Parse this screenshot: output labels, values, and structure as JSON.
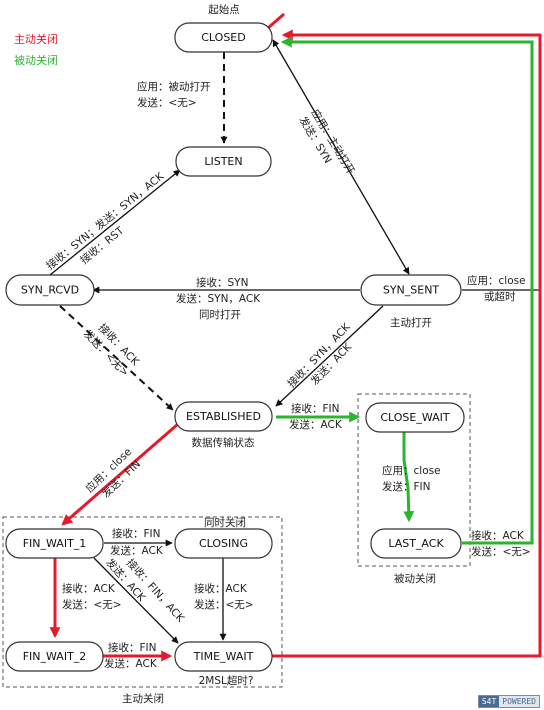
{
  "title": "起始点",
  "legend": {
    "active_close": {
      "text": "主动关闭",
      "color": "#e8192c"
    },
    "passive_close": {
      "text": "被动关闭",
      "color": "#2ab52e"
    }
  },
  "states": {
    "closed": "CLOSED",
    "listen": "LISTEN",
    "syn_rcvd": "SYN_RCVD",
    "syn_sent": "SYN_SENT",
    "established": "ESTABLISHED",
    "close_wait": "CLOSE_WAIT",
    "last_ack": "LAST_ACK",
    "fin_wait_1": "FIN_WAIT_1",
    "closing": "CLOSING",
    "fin_wait_2": "FIN_WAIT_2",
    "time_wait": "TIME_WAIT"
  },
  "labels": {
    "closed_listen_1": "应用：被动打开",
    "closed_listen_2": "发送：<无>",
    "closed_synsent_1": "应用：主动打开",
    "closed_synsent_2": "发送：SYN",
    "synrcvd_listen_1": "接收：SYN；发送：SYN，ACK",
    "synrcvd_listen_2": "接收：RST",
    "simul_1": "接收：SYN",
    "simul_2": "发送：SYN，ACK",
    "simul_3": "同时打开",
    "synsent_close_1": "应用：close",
    "synsent_close_2": "或超时",
    "synsent_caption": "主动打开",
    "synrcvd_est_1": "接收：ACK",
    "synrcvd_est_2": "发送：<无>",
    "synsent_est_1": "接收：SYN，ACK",
    "synsent_est_2": "发送：ACK",
    "est_cw_1": "接收：FIN",
    "est_cw_2": "发送：ACK",
    "est_caption": "数据传输状态",
    "est_fw1_1": "应用：close",
    "est_fw1_2": "发送：FIN",
    "cw_la_1": "应用：close",
    "cw_la_2": "发送：FIN",
    "la_closed_1": "接收：ACK",
    "la_closed_2": "发送：<无>",
    "passive_caption": "被动关闭",
    "fw1_closing_1": "接收：FIN",
    "fw1_closing_2": "发送：ACK",
    "simul_close": "同时关闭",
    "fw1_fw2_1": "接收：ACK",
    "fw1_fw2_2": "发送：<无>",
    "fw1_tw_1": "接收：FIN，ACK",
    "fw1_tw_2": "发送：ACK",
    "closing_tw_1": "接收：ACK",
    "closing_tw_2": "发送：<无>",
    "fw2_tw_1": "接收：FIN",
    "fw2_tw_2": "发送：ACK",
    "msl": "2MSL超时?",
    "active_caption": "主动关闭"
  },
  "badge": {
    "left": "S4T",
    "right": "POWERED"
  }
}
